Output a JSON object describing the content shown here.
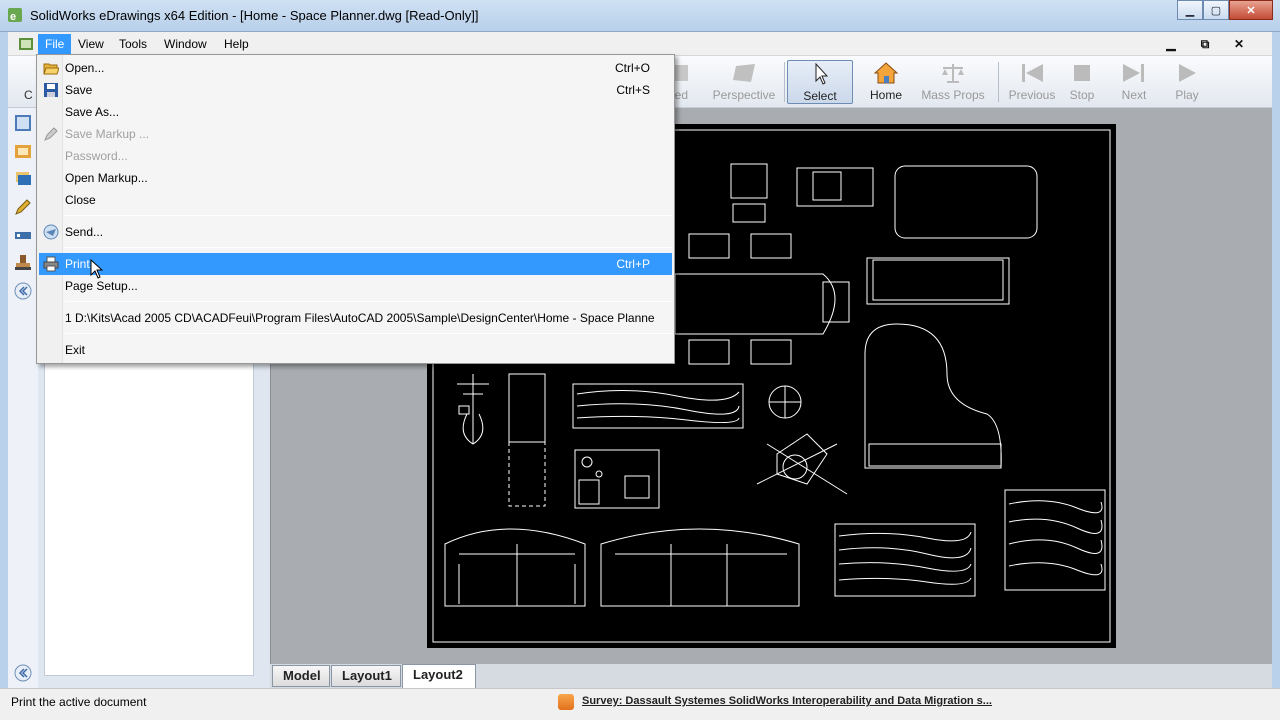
{
  "window": {
    "title": "SolidWorks eDrawings x64 Edition - [Home - Space Planner.dwg [Read-Only]]",
    "min_glyph": "▁",
    "max_glyph": "▢",
    "close_glyph": "✕"
  },
  "menubar": {
    "items": [
      "File",
      "View",
      "Tools",
      "Window",
      "Help"
    ],
    "active": "File",
    "mdi_min": "▁",
    "mdi_restore": "⧉",
    "mdi_close": "✕"
  },
  "toolbar": {
    "partial_left": "C",
    "buttons": [
      {
        "label": "ded",
        "icon": "shaded-icon",
        "enabled": false
      },
      {
        "label": "Perspective",
        "icon": "perspective-icon",
        "enabled": false
      },
      {
        "label": "Select",
        "icon": "select-arrow-icon",
        "enabled": true,
        "selected": true
      },
      {
        "label": "Home",
        "icon": "home-icon",
        "enabled": true
      },
      {
        "label": "Mass Props",
        "icon": "mass-props-icon",
        "enabled": false
      },
      {
        "label": "Previous",
        "icon": "previous-icon",
        "enabled": false
      },
      {
        "label": "Stop",
        "icon": "stop-icon",
        "enabled": false
      },
      {
        "label": "Next",
        "icon": "next-icon",
        "enabled": false
      },
      {
        "label": "Play",
        "icon": "play-icon",
        "enabled": false
      }
    ]
  },
  "file_menu": {
    "items": [
      {
        "label": "Open...",
        "shortcut": "Ctrl+O",
        "icon": "open-folder-icon",
        "enabled": true
      },
      {
        "label": "Save",
        "shortcut": "Ctrl+S",
        "icon": "save-disk-icon",
        "enabled": true
      },
      {
        "label": "Save As...",
        "shortcut": "",
        "enabled": true
      },
      {
        "label": "Save Markup ...",
        "shortcut": "",
        "icon": "save-markup-icon",
        "enabled": false
      },
      {
        "label": "Password...",
        "shortcut": "",
        "enabled": false
      },
      {
        "label": "Open Markup...",
        "shortcut": "",
        "enabled": true
      },
      {
        "label": "Close",
        "shortcut": "",
        "enabled": true
      },
      {
        "label": "Send...",
        "shortcut": "",
        "icon": "send-icon",
        "enabled": true
      },
      {
        "label": "Print...",
        "shortcut": "Ctrl+P",
        "icon": "printer-icon",
        "enabled": true,
        "highlighted": true
      },
      {
        "label": "Page Setup...",
        "shortcut": "",
        "enabled": true
      },
      {
        "label": "1 D:\\Kits\\Acad 2005 CD\\ACADFeui\\Program Files\\AutoCAD 2005\\Sample\\DesignCenter\\Home - Space Planne",
        "shortcut": "",
        "enabled": true
      },
      {
        "label": "Exit",
        "shortcut": "",
        "enabled": true
      }
    ]
  },
  "tabs": [
    "Model",
    "Layout1",
    "Layout2"
  ],
  "active_tab": "Layout2",
  "status": {
    "text": "Print the active document",
    "news": "Survey: Dassault Systemes SolidWorks Interoperability and Data Migration s..."
  },
  "colors": {
    "highlight": "#3399ff",
    "drawing_bg": "#000000",
    "viewport_bg": "#a9acb0"
  }
}
